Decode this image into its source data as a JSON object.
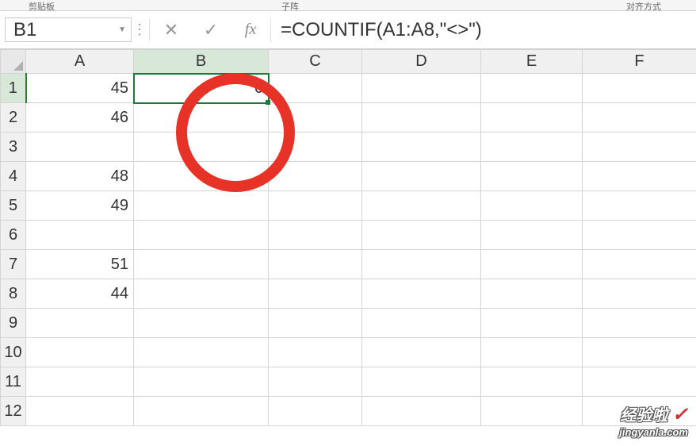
{
  "top_fragments": {
    "left": "剪贴板",
    "mid": "子阵",
    "right": "对齐方式"
  },
  "name_box": {
    "value": "B1"
  },
  "formula": "=COUNTIF(A1:A8,\"<>\")",
  "columns": [
    "A",
    "B",
    "C",
    "D",
    "E",
    "F"
  ],
  "rows": [
    "1",
    "2",
    "3",
    "4",
    "5",
    "6",
    "7",
    "8",
    "9",
    "10",
    "11",
    "12"
  ],
  "selected": {
    "col": "B",
    "row": "1"
  },
  "cells": {
    "A1": "45",
    "A2": "46",
    "A4": "48",
    "A5": "49",
    "A7": "51",
    "A8": "44",
    "B1": "6"
  },
  "chart_data": {
    "type": "table",
    "note": "Spreadsheet cell data; B1 computes COUNTIF over A1:A8 non-empty cells",
    "columns": [
      "A",
      "B"
    ],
    "rows": [
      {
        "row": 1,
        "A": 45,
        "B": 6
      },
      {
        "row": 2,
        "A": 46
      },
      {
        "row": 3
      },
      {
        "row": 4,
        "A": 48
      },
      {
        "row": 5,
        "A": 49
      },
      {
        "row": 6
      },
      {
        "row": 7,
        "A": 51
      },
      {
        "row": 8,
        "A": 44
      }
    ]
  },
  "watermark": {
    "line1": "经验啦",
    "check": "✓",
    "line2": "jingyanla.com"
  }
}
